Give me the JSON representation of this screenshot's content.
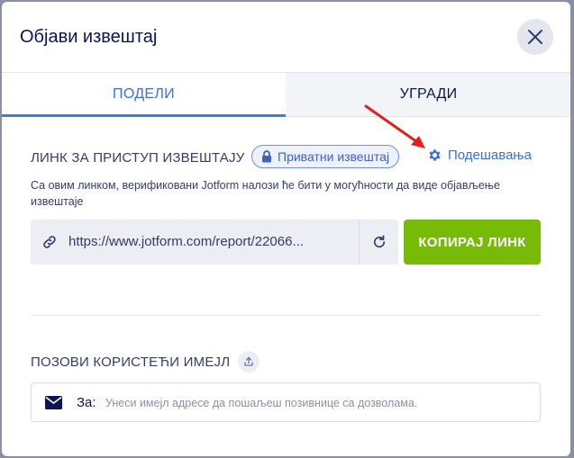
{
  "dialog": {
    "title": "Објави извештај"
  },
  "tabs": [
    {
      "label": "ПОДЕЛИ",
      "active": true
    },
    {
      "label": "УГРАДИ",
      "active": false
    }
  ],
  "link_section": {
    "label": "ЛИНК ЗА ПРИСТУП ИЗВЕШТАЈУ",
    "badge": "Приватни извештај",
    "settings_label": "Подешавања",
    "description": "Са овим линком, верификовани Jotform налози ће бити у могућности да виде објављење извештаје",
    "url": "https://www.jotform.com/report/22066...",
    "copy_label": "КОПИРАЈ ЛИНК"
  },
  "invite_section": {
    "label": "ПОЗОВИ КОРИСТЕЋИ ИМЕЈЛ",
    "to_label": "За:",
    "placeholder": "Унеси имејл адресе да пошаљеш позивнице са дозволама."
  },
  "icons": {
    "close": "close-icon",
    "lock": "lock-icon",
    "gear": "gear-icon",
    "link": "link-icon",
    "refresh": "refresh-icon",
    "share": "share-icon",
    "mail": "mail-icon"
  },
  "colors": {
    "accent": "#4277e8",
    "copy_button": "#78bb07",
    "annotation_arrow": "#e02020"
  }
}
